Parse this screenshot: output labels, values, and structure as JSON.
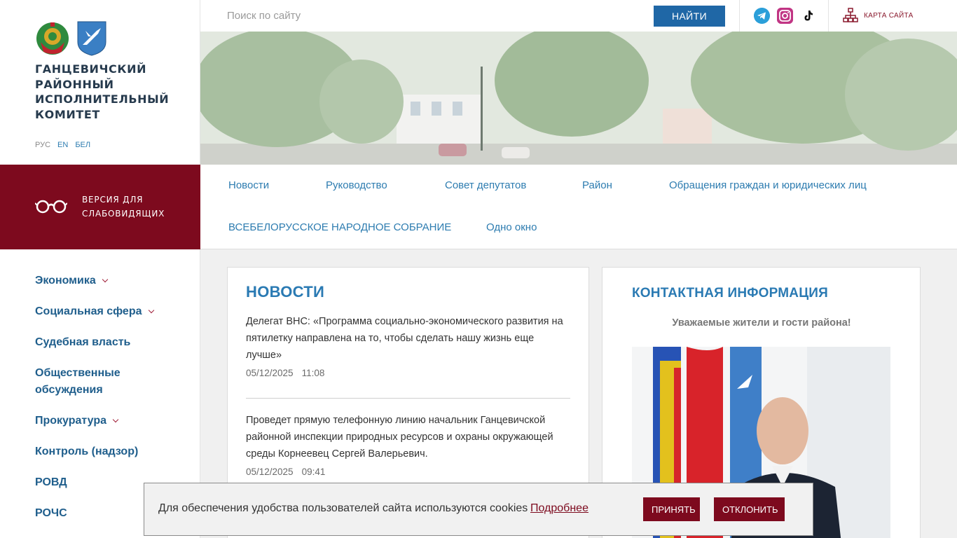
{
  "org": {
    "name": "ГАНЦЕВИЧСКИЙ РАЙОННЫЙ ИСПОЛНИТЕЛЬНЫЙ КОМИТЕТ",
    "languages": [
      "РУС",
      "EN",
      "БЕЛ"
    ]
  },
  "vision": {
    "label": "ВЕРСИЯ ДЛЯ СЛАБОВИДЯЩИХ"
  },
  "side_menu": [
    {
      "label": "Экономика",
      "has_children": true
    },
    {
      "label": "Социальная сфера",
      "has_children": true
    },
    {
      "label": "Судебная власть",
      "has_children": false
    },
    {
      "label": "Общественные обсуждения",
      "has_children": false
    },
    {
      "label": "Прокуратура",
      "has_children": true
    },
    {
      "label": "Контроль (надзор)",
      "has_children": false
    },
    {
      "label": "РОВД",
      "has_children": false
    },
    {
      "label": "РОЧС",
      "has_children": false
    }
  ],
  "search": {
    "placeholder": "Поиск по сайту",
    "button": "НАЙТИ"
  },
  "social": [
    "telegram-icon",
    "instagram-icon",
    "tiktok-icon"
  ],
  "sitemap": {
    "label": "КАРТА САЙТА"
  },
  "topnav": [
    "Новости",
    "Руководство",
    "Совет депутатов",
    "Район",
    "Обращения граждан и юридических лиц",
    "ВСЕБЕЛОРУССКОЕ НАРОДНОЕ СОБРАНИЕ",
    "Одно окно"
  ],
  "news": {
    "title": "НОВОСТИ",
    "items": [
      {
        "text": "Делегат ВНС: «Программа социально-экономического развития на пятилетку направлена на то, чтобы сделать нашу жизнь еще лучше»",
        "date": "05/12/2025",
        "time": "11:08"
      },
      {
        "text": "Проведет прямую телефонную линию начальник Ганцевичской районной инспекции природных ресурсов и охраны окружающей среды Корнеевец Сергей Валерьевич.",
        "date": "05/12/2025",
        "time": "09:41"
      }
    ]
  },
  "contact": {
    "title": "КОНТАКТНАЯ ИНФОРМАЦИЯ",
    "subtitle": "Уважаемые жители и гости района!"
  },
  "cookie": {
    "text": "Для обеспечения удобства пользователей сайта используются cookies",
    "more": "Подробнее",
    "accept": "ПРИНЯТЬ",
    "decline": "ОТКЛОНИТЬ"
  },
  "colors": {
    "brand_red": "#7d0a1e",
    "link_blue": "#2d7cb0",
    "button_blue": "#1f67a6"
  }
}
